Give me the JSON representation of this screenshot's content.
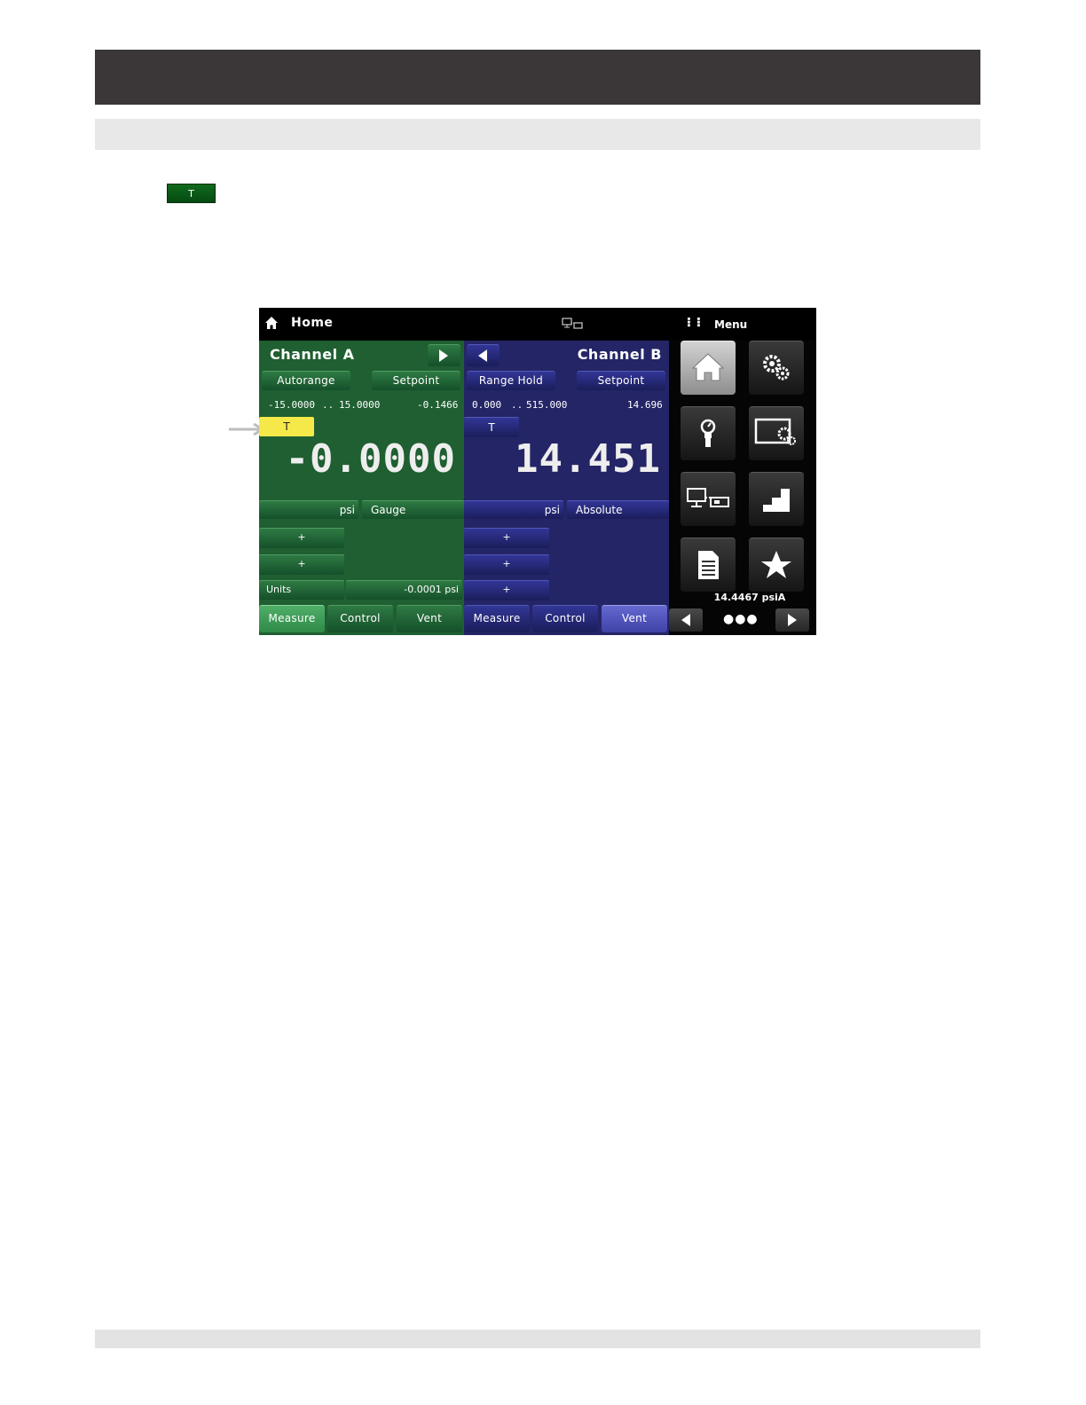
{
  "document": {
    "inline_key_label": "T"
  },
  "screen": {
    "topbar": {
      "title": "Home",
      "grid_glyph": "⠇⠇",
      "menu_label": "Menu"
    },
    "channel_a": {
      "title": "Channel A",
      "buttons": [
        "Autorange",
        "Setpoint"
      ],
      "range_low": "-15.0000",
      "range_sep": "..",
      "range_high": "15.0000",
      "setpoint_value": "-0.1466",
      "tare_label": "T",
      "reading": "-0.0000",
      "unit": "psi",
      "mode": "Gauge",
      "plus_buttons": [
        "+",
        "+"
      ],
      "units_label": "Units",
      "units_value": "-0.0001 psi",
      "tabs": [
        "Measure",
        "Control",
        "Vent"
      ]
    },
    "channel_b": {
      "title": "Channel B",
      "buttons": [
        "Range Hold",
        "Setpoint"
      ],
      "range_low": "0.000",
      "range_sep": "..",
      "range_high": "515.000",
      "setpoint_value": "14.696",
      "tare_label": "T",
      "reading": "14.451",
      "unit": "psi",
      "mode": "Absolute",
      "plus_buttons": [
        "+",
        "+",
        "+"
      ],
      "tabs": [
        "Measure",
        "Control",
        "Vent"
      ]
    },
    "menu_panel": {
      "tiles": [
        "home-icon",
        "settings-gears-icon",
        "sensor-icon",
        "display-settings-icon",
        "remote-computer-icon",
        "step-program-icon",
        "document-icon",
        "favorites-star-icon"
      ],
      "barometer": "14.4467 psiA",
      "page_dots": "●●●"
    }
  },
  "colors": {
    "channel_a_bg": "#1f5f31",
    "channel_b_bg": "#242566",
    "highlight": "#f5e94a",
    "header_bar": "#3b3738"
  }
}
